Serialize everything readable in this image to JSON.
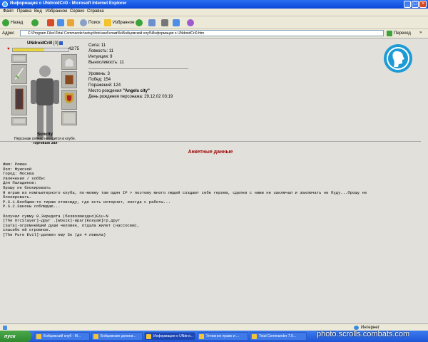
{
  "window": {
    "title": "Информация о UNdroidCri0 - Microsoft Internet Explorer"
  },
  "menu": [
    "Файл",
    "Правка",
    "Вид",
    "Избранное",
    "Сервис",
    "Справка"
  ],
  "toolbar": {
    "back": "Назад",
    "search": "Поиск",
    "favorites": "Избранное"
  },
  "address": {
    "label": "Адрес",
    "value": "C:\\Program Files\\Total Commander\\setup\\foto\\asel\\хлам\\бк\\Бойцовский клуб\\Информация о UNdroidCri0.htm",
    "go": "Переход",
    "links": "»"
  },
  "character": {
    "nick": "UNdroidCri0",
    "level": "[3]",
    "hp": "42/75",
    "hp_fraction": 0.56,
    "location_name": "Suncity",
    "location_text": "Персонаж сейчас находится в клубе.",
    "room": "\"Торговый Зал\""
  },
  "stats": [
    {
      "label": "Сила:",
      "value": "11"
    },
    {
      "label": "Ловкость:",
      "value": "11"
    },
    {
      "label": "Интуиция:",
      "value": "9"
    },
    {
      "label": "Выносливость:",
      "value": "11"
    }
  ],
  "info": [
    {
      "label": "Уровень:",
      "value": "3"
    },
    {
      "label": "Побед:",
      "value": "154"
    },
    {
      "label": "Поражений:",
      "value": "124"
    },
    {
      "label": "Место рождения",
      "value": "\"Angels city\""
    },
    {
      "label": "День рождения персонажа:",
      "value": "29.12.02 03:19"
    }
  ],
  "profile": {
    "title": "Анкетные данные",
    "lines": [
      "Имя: Роман",
      "Пол: Мужской",
      "Город: Москва",
      "Увлечения / хобби:",
      "Для Паладинов:",
      "Прошу не блокировать",
      "Я играю из компьютерного клуба, по-моему там один IP > поэтому много людей создают себе героев, сделки с ними не заключал и заключать не буду...Прошу не",
      "блокировать.",
      "P.S.1.Вообщем-то тираю отовсюду, где есть интернет, иногда с работы...",
      "P.S.2.Законы соблюдаю...",
      "",
      "Получил сумму 0.3кредита (безвозмездно)Giu-N",
      "[The OrcSlayer]-друг .[Wosik]-враг[KosyaK]гр.друг",
      "[SaTa]-огромнейший души человек, отдала жилет (нассосем),",
      "спасибо ей огромное.",
      "[The Pure Evil]-должен ему 5к (до 4 левела)"
    ]
  },
  "status": {
    "zone": "Интернет"
  },
  "taskbar": {
    "start": "пуск",
    "tasks": [
      "Бойцовский клуб - М...",
      "Бойцовские дневни...",
      "Информация о UNdroi...",
      "Угловное право и ...",
      "Total Commander 7.0..."
    ]
  },
  "watermark": "photo.scrolls.combats.com"
}
